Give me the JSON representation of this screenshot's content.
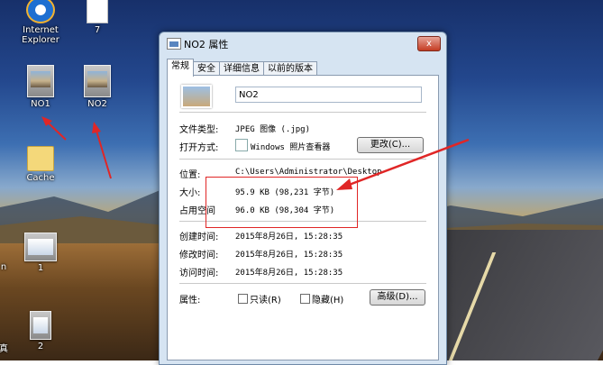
{
  "desktop": {
    "icons": [
      {
        "label": "Internet\nExplorer"
      },
      {
        "label": "7"
      },
      {
        "label": "NO1"
      },
      {
        "label": "NO2"
      },
      {
        "label": "Cache"
      },
      {
        "label": "1"
      },
      {
        "label": "2"
      }
    ],
    "edge_labels": [
      "n",
      "真"
    ]
  },
  "dialog": {
    "title": "NO2 属性",
    "close_label": "x",
    "tabs": [
      "常规",
      "安全",
      "详细信息",
      "以前的版本"
    ],
    "filename": "NO2",
    "fields": {
      "type_label": "文件类型:",
      "type_value": "JPEG 图像 (.jpg)",
      "opens_label": "打开方式:",
      "opens_value": "Windows 照片查看器",
      "change_button": "更改(C)...",
      "location_label": "位置:",
      "location_value": "C:\\Users\\Administrator\\Desktop",
      "size_label": "大小:",
      "size_value": "95.9 KB (98,231 字节)",
      "disk_label": "占用空间",
      "disk_value": "96.0 KB (98,304 字节)",
      "created_label": "创建时间:",
      "created_value": "2015年8月26日, 15:28:35",
      "modified_label": "修改时间:",
      "modified_value": "2015年8月26日, 15:28:35",
      "accessed_label": "访问时间:",
      "accessed_value": "2015年8月26日, 15:28:35",
      "attributes_label": "属性:",
      "readonly_label": "只读(R)",
      "hidden_label": "隐藏(H)",
      "advanced_button": "高级(D)..."
    }
  },
  "colors": {
    "annotation_red": "#e02626",
    "dialog_frame": "#d6e4f2"
  }
}
